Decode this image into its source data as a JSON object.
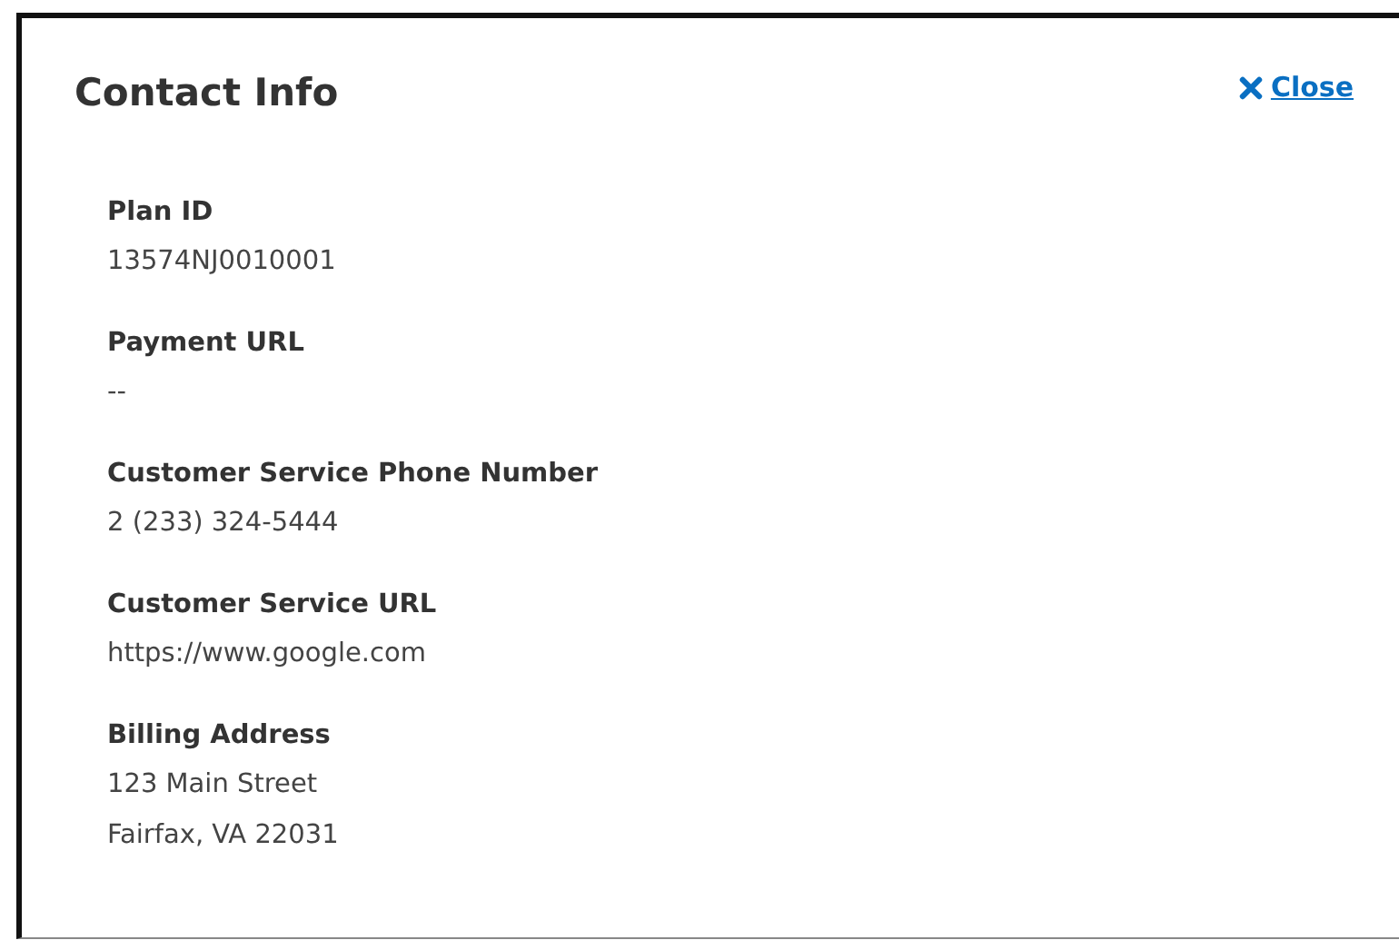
{
  "dialog": {
    "title": "Contact Info",
    "close": {
      "label": "Close"
    },
    "fields": [
      {
        "label": "Plan ID",
        "lines": [
          "13574NJ0010001"
        ]
      },
      {
        "label": "Payment URL",
        "lines": [
          "--"
        ]
      },
      {
        "label": "Customer Service Phone Number",
        "lines": [
          "2 (233) 324-5444"
        ]
      },
      {
        "label": "Customer Service URL",
        "lines": [
          "https://www.google.com"
        ]
      },
      {
        "label": "Billing Address",
        "lines": [
          "123 Main Street",
          "Fairfax, VA 22031"
        ]
      }
    ]
  }
}
